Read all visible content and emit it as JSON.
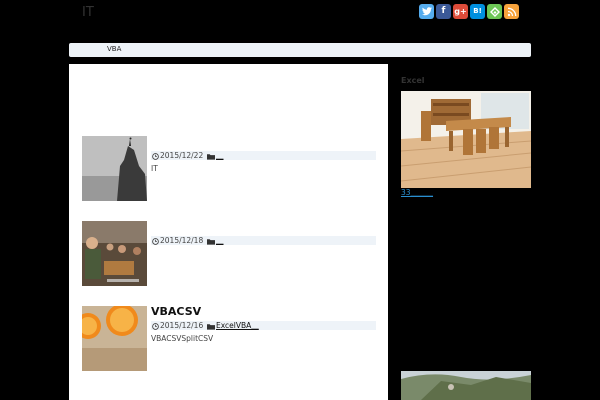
{
  "header": {
    "site_title": "IT"
  },
  "social": [
    "twitter-icon",
    "facebook-icon",
    "google-plus-icon",
    "hatena-bookmark-icon",
    "feedly-icon",
    "rss-icon"
  ],
  "social_labels": {
    "facebook": "f",
    "google": "g+",
    "hatena": "B!"
  },
  "colors": {
    "twitter": "#55acee",
    "facebook": "#3b5998",
    "google": "#dd4b39",
    "hatena": "#008fde",
    "feedly": "#6cc655",
    "rss": "#f7a33c",
    "nav_bg": "#eef3f8",
    "link": "#2a8fd0"
  },
  "nav": {
    "items": [
      {
        "label": "VBA"
      }
    ]
  },
  "posts": [
    {
      "title": "",
      "date": "2015/12/22",
      "category": "＿",
      "excerpt": "IT"
    },
    {
      "title": "",
      "date": "2015/12/18",
      "category": "＿",
      "excerpt": ""
    },
    {
      "title": "VBACSV",
      "date": "2015/12/16",
      "category": "ExcelVBA＿",
      "excerpt": "VBACSVSplitCSV"
    }
  ],
  "sidebar": {
    "heading": "Excel",
    "link_text": "33＿＿＿"
  }
}
